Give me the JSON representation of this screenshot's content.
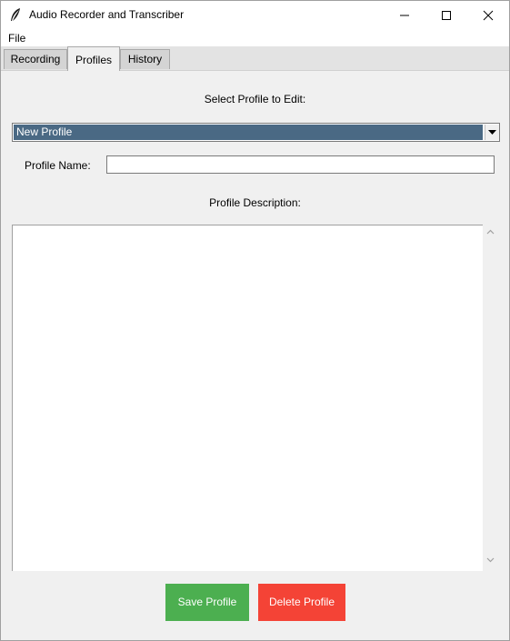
{
  "window": {
    "title": "Audio Recorder and Transcriber"
  },
  "menu": {
    "items": [
      "File"
    ]
  },
  "tabs": [
    {
      "label": "Recording",
      "selected": false
    },
    {
      "label": "Profiles",
      "selected": true
    },
    {
      "label": "History",
      "selected": false
    }
  ],
  "profiles": {
    "select_label": "Select Profile to Edit:",
    "selected_profile": "New Profile",
    "name_label": "Profile Name:",
    "name_value": "",
    "description_label": "Profile Description:",
    "description_value": "",
    "save_label": "Save Profile",
    "delete_label": "Delete Profile"
  },
  "colors": {
    "selection": "#4a6984",
    "save_button": "#4caf50",
    "delete_button": "#f44336"
  },
  "icons": [
    "feather-icon",
    "minimize-icon",
    "maximize-icon",
    "close-icon",
    "dropdown-arrow-icon",
    "scroll-up-icon",
    "scroll-down-icon"
  ]
}
